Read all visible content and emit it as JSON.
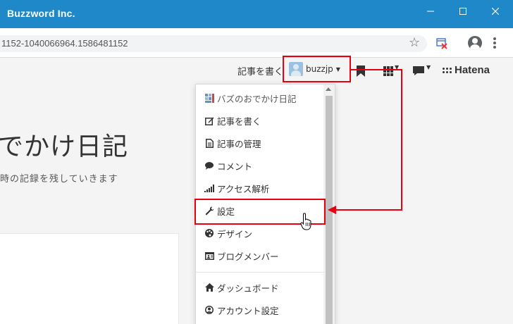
{
  "window": {
    "title": "Buzzword Inc."
  },
  "address_bar": {
    "url": "1152-1040066964.1586481152"
  },
  "page": {
    "blog_title": "でかけ日記",
    "blog_description": "時の記録を残していきます"
  },
  "hatena_bar": {
    "write_label": "記事を書く",
    "username": "buzzjp",
    "logo_text": "Hatena"
  },
  "dropdown": {
    "items": [
      {
        "label": "バズのおでかけ日記",
        "icon": "blog-icon"
      },
      {
        "label": "記事を書く",
        "icon": "edit-icon"
      },
      {
        "label": "記事の管理",
        "icon": "document-icon"
      },
      {
        "label": "コメント",
        "icon": "comment-icon"
      },
      {
        "label": "アクセス解析",
        "icon": "signal-icon"
      },
      {
        "label": "設定",
        "icon": "wrench-icon"
      },
      {
        "label": "デザイン",
        "icon": "palette-icon"
      },
      {
        "label": "ブログメンバー",
        "icon": "id-card-icon"
      },
      {
        "label": "ダッシュボード",
        "icon": "home-icon"
      },
      {
        "label": "アカウント設定",
        "icon": "user-circle-icon"
      }
    ]
  },
  "colors": {
    "titlebar": "#1e88c8",
    "highlight": "#e60012"
  }
}
